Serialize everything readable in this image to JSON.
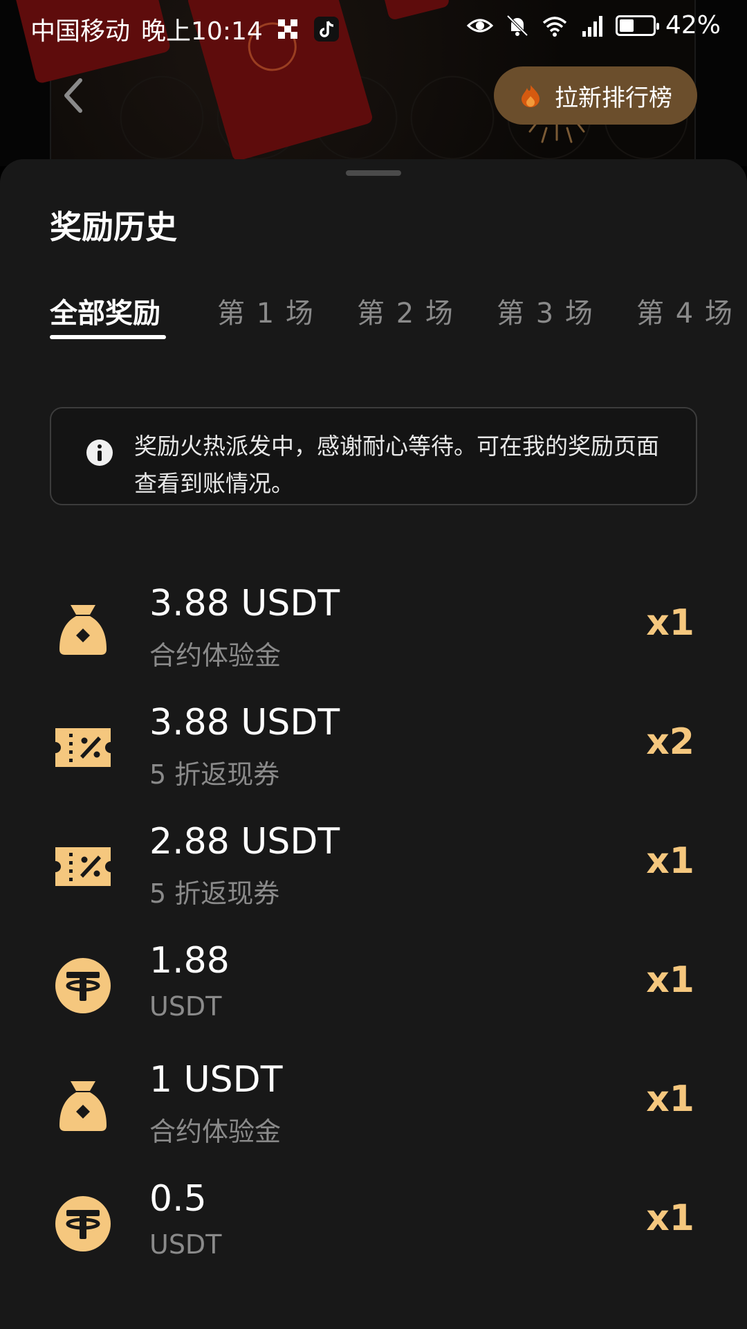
{
  "status_bar": {
    "carrier": "中国移动",
    "time": "晚上10:14",
    "battery_percent": "42%",
    "battery_level": 0.42
  },
  "header": {
    "leaderboard_label": "拉新排行榜"
  },
  "sheet": {
    "title": "奖励历史",
    "tabs": [
      "全部奖励",
      "第 1 场",
      "第 2 场",
      "第 3 场",
      "第 4 场"
    ],
    "active_tab": 0,
    "notice": "奖励火热派发中，感谢耐心等待。可在我的奖励页面查看到账情况。"
  },
  "rewards": [
    {
      "icon": "money-bag-icon",
      "amount": "3.88 USDT",
      "subtitle": "合约体验金",
      "qty": "x1"
    },
    {
      "icon": "coupon-icon",
      "amount": "3.88 USDT",
      "subtitle": "5 折返现券",
      "qty": "x2"
    },
    {
      "icon": "coupon-icon",
      "amount": "2.88 USDT",
      "subtitle": "5 折返现券",
      "qty": "x1"
    },
    {
      "icon": "tether-coin-icon",
      "amount": "1.88",
      "subtitle": "USDT",
      "qty": "x1"
    },
    {
      "icon": "money-bag-icon",
      "amount": "1 USDT",
      "subtitle": "合约体验金",
      "qty": "x1"
    },
    {
      "icon": "tether-coin-icon",
      "amount": "0.5",
      "subtitle": "USDT",
      "qty": "x1"
    }
  ],
  "colors": {
    "accent": "#f5c77e",
    "sheet_bg": "#181818",
    "leaderboard_btn": "#6b4e2c"
  }
}
